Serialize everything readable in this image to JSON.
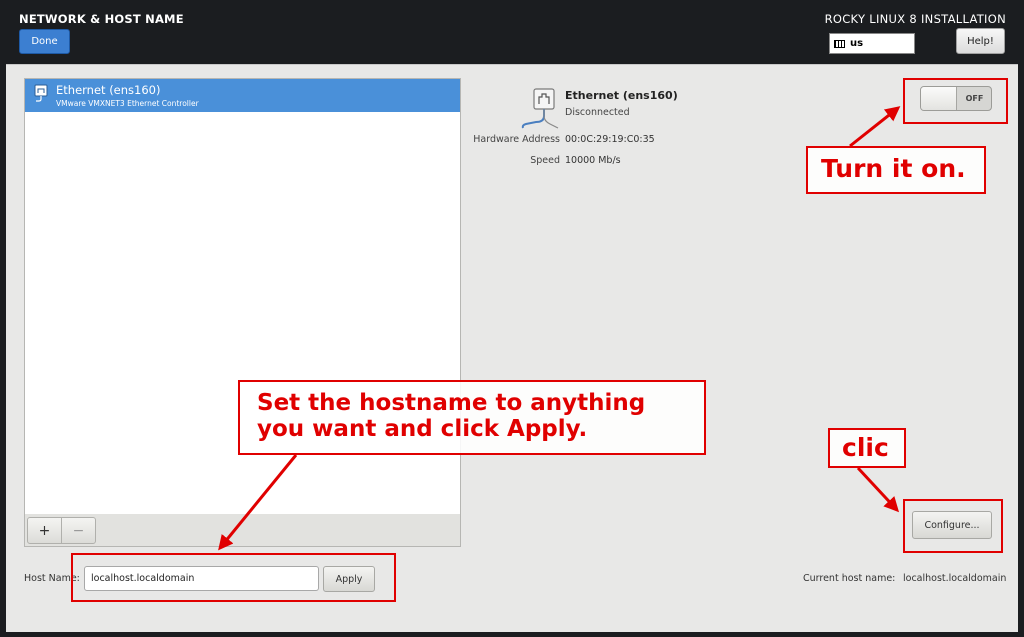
{
  "header": {
    "spoke_title": "NETWORK & HOST NAME",
    "done_label": "Done",
    "install_title": "ROCKY LINUX 8 INSTALLATION",
    "keyboard_layout": "us",
    "help_label": "Help!"
  },
  "device_list": {
    "items": [
      {
        "name": "Ethernet (ens160)",
        "description": "VMware VMXNET3 Ethernet Controller",
        "selected": true
      }
    ],
    "add_label": "+",
    "remove_label": "−"
  },
  "device_detail": {
    "name": "Ethernet (ens160)",
    "status": "Disconnected",
    "hardware_address_label": "Hardware Address",
    "hardware_address": "00:0C:29:19:C0:35",
    "speed_label": "Speed",
    "speed": "10000 Mb/s",
    "toggle_state": "OFF",
    "configure_label": "Configure..."
  },
  "hostname": {
    "label": "Host Name:",
    "value": "localhost.localdomain",
    "apply_label": "Apply",
    "current_label": "Current host name:",
    "current_value": "localhost.localdomain"
  },
  "annotations": {
    "turn_on": "Turn it on.",
    "clic": "clic",
    "set_hostname_line1": "Set the hostname to anything",
    "set_hostname_line2": "you want and click Apply."
  },
  "colors": {
    "header_bg": "#1b1d20",
    "panel_bg": "#e8e8e7",
    "selection_blue": "#4a90d9",
    "done_blue": "#3c7fd1",
    "annotation_red": "#e00000"
  },
  "icons": {
    "keyboard": "keyboard-icon",
    "ethernet": "ethernet-icon"
  }
}
